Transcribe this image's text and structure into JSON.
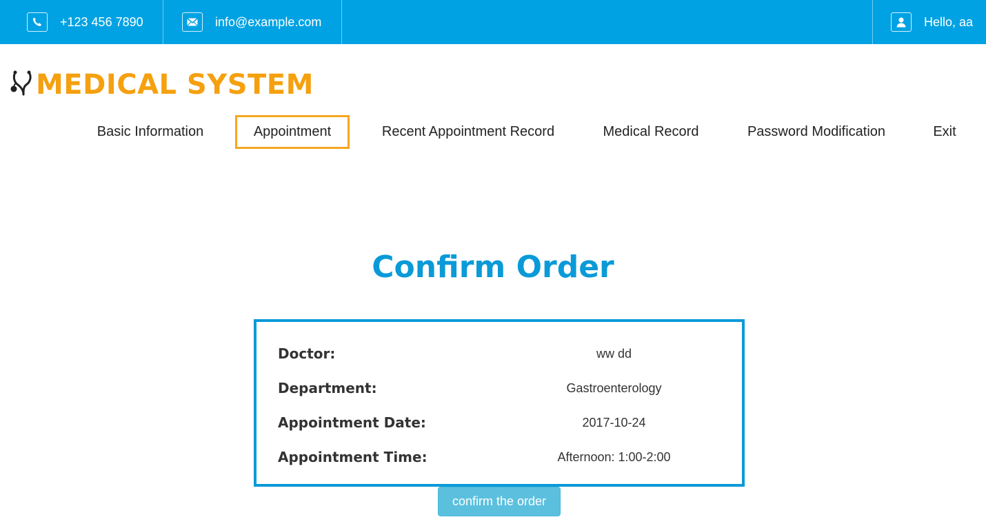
{
  "topbar": {
    "phone": "+123 456 7890",
    "email": "info@example.com",
    "greeting": "Hello, aa",
    "background": "#00a2e3"
  },
  "logo": {
    "text": "MEDICAL SYSTEM",
    "color": "#f5a00f",
    "icon": "stethoscope-icon"
  },
  "nav": {
    "items": [
      {
        "label": "Basic Information"
      },
      {
        "label": "Appointment"
      },
      {
        "label": "Recent Appointment Record"
      },
      {
        "label": "Medical Record"
      },
      {
        "label": "Password Modification"
      },
      {
        "label": "Exit"
      }
    ],
    "active_index": 1,
    "active_color": "#f5a623"
  },
  "main": {
    "title": "Confirm Order",
    "rows": [
      {
        "label": "Doctor:",
        "value": "ww dd"
      },
      {
        "label": "Department:",
        "value": "Gastroenterology"
      },
      {
        "label": "Appointment Date:",
        "value": "2017-10-24"
      },
      {
        "label": "Appointment Time:",
        "value": "Afternoon: 1:00-2:00"
      }
    ],
    "confirm_label": "confirm the order",
    "accent": "#0a9ad8"
  }
}
